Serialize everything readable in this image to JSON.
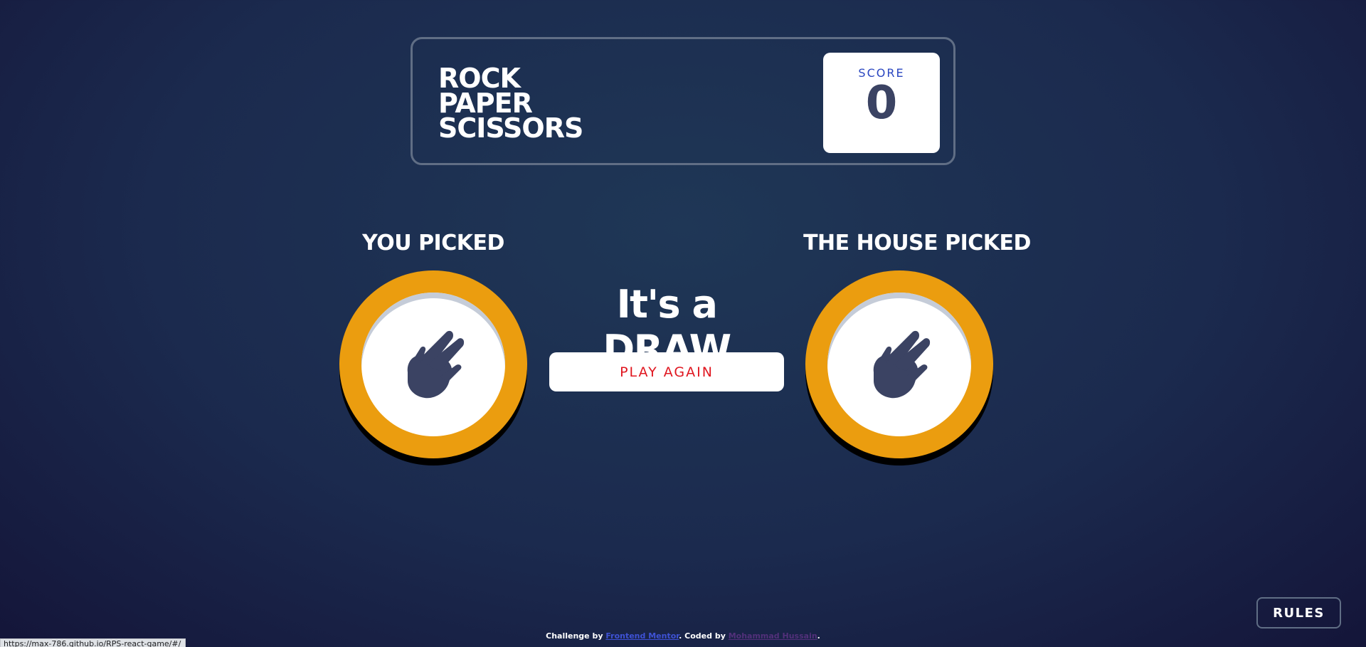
{
  "header": {
    "title_lines": [
      "ROCK",
      "PAPER",
      "SCISSORS"
    ],
    "score_label": "SCORE",
    "score_value": "0"
  },
  "game": {
    "player_label": "YOU PICKED",
    "house_label": "THE HOUSE PICKED",
    "player_pick": "scissors",
    "house_pick": "scissors",
    "result_text": "It's a DRAW",
    "play_again_label": "PLAY AGAIN",
    "token_color": "#eb9d0f",
    "icon": "scissors-hand-icon"
  },
  "rules_button": {
    "label": "RULES"
  },
  "footer": {
    "challenge_prefix": "Challenge by ",
    "challenge_link": "Frontend Mentor",
    "coded_prefix": ". Coded by ",
    "author_link": "Mohammad Hussain",
    "suffix": "."
  },
  "status_bar": {
    "url": "https://max-786.github.io/RPS-react-game/#/"
  },
  "colors": {
    "accent_red": "#e0161f",
    "score_text": "#3b4363",
    "score_label": "#2a46c0"
  }
}
